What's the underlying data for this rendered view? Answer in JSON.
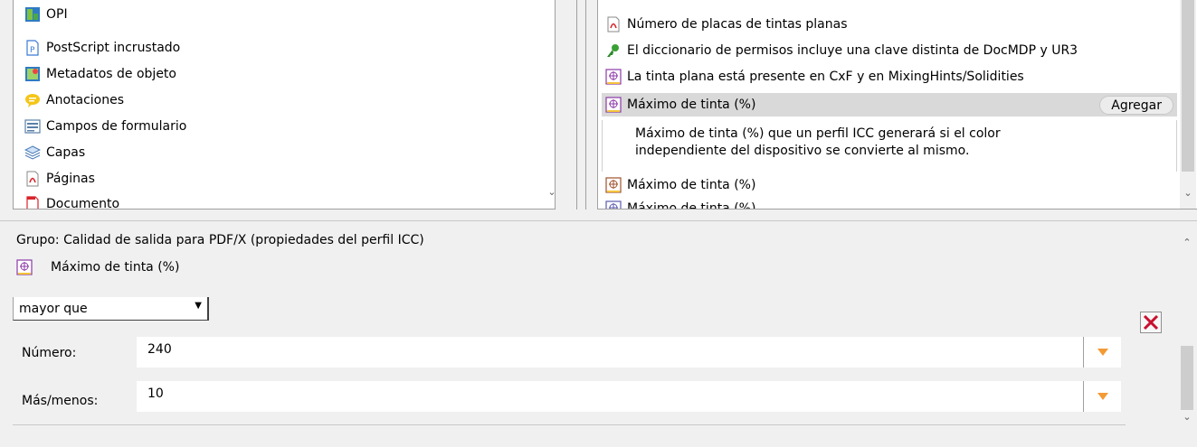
{
  "left_list": {
    "items": [
      {
        "label": "OPI",
        "icon": "opi-icon"
      },
      {
        "label": "PostScript incrustado",
        "icon": "postscript-icon"
      },
      {
        "label": "Metadatos de objeto",
        "icon": "object-metadata-icon"
      },
      {
        "label": "Anotaciones",
        "icon": "annotation-icon"
      },
      {
        "label": "Campos de formulario",
        "icon": "form-field-icon"
      },
      {
        "label": "Capas",
        "icon": "layers-icon"
      },
      {
        "label": "Páginas",
        "icon": "pdf-page-icon"
      },
      {
        "label": "Documento",
        "icon": "document-icon"
      }
    ]
  },
  "right_list": {
    "items": [
      {
        "label": "Número de placas de tintas planas",
        "icon": "pdf-page-icon"
      },
      {
        "label": "El diccionario de permisos incluye una clave distinta de DocMDP y UR3",
        "icon": "permissions-icon"
      },
      {
        "label": "La tinta plana está presente en CxF y en MixingHints/Solidities",
        "icon": "output-intent-icon"
      },
      {
        "label": "Máximo de tinta (%)",
        "icon": "output-intent-icon",
        "selected": true
      },
      {
        "label": "Máximo de tinta (%)",
        "icon": "output-intent-icon"
      },
      {
        "label": "Máximo de tinta (%)",
        "icon": "output-intent-icon"
      }
    ],
    "add_button": "Agregar",
    "description_line1": "Máximo de tinta (%) que un perfil ICC generará si el color",
    "description_line2": "independiente del dispositivo se convierte al mismo."
  },
  "editor": {
    "group_label": "Grupo:",
    "group_value": "Calidad de salida para PDF/X (propiedades del perfil ICC)",
    "property_label": "Máximo de tinta (%)",
    "operator_value": "mayor que",
    "number_label": "Número:",
    "number_value": "240",
    "plusminus_label": "Más/menos:",
    "plusminus_value": "10"
  },
  "colors": {
    "accent_orange": "#f39a35",
    "delete_red": "#c8102e",
    "selection_gray": "#d9d9d9"
  }
}
